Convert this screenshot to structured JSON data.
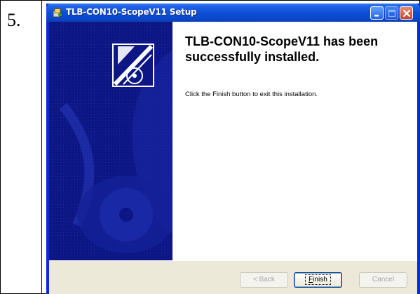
{
  "document": {
    "step_number": "5."
  },
  "window": {
    "title": "TLB-CON10-ScopeV11 Setup",
    "colors": {
      "titlebar": "#0a46c9",
      "banner": "#0c1684",
      "footer": "#ece9d8"
    },
    "icons": {
      "app": "installer-icon",
      "minimize": "minimize-icon",
      "maximize": "maximize-icon",
      "close": "close-icon",
      "logo": "setup-logo-icon"
    }
  },
  "content": {
    "heading": "TLB-CON10-ScopeV11 has been successfully installed.",
    "message": "Click the Finish button to exit this installation."
  },
  "buttons": {
    "back": "< Back",
    "finish": "Finish",
    "cancel": "Cancel"
  }
}
